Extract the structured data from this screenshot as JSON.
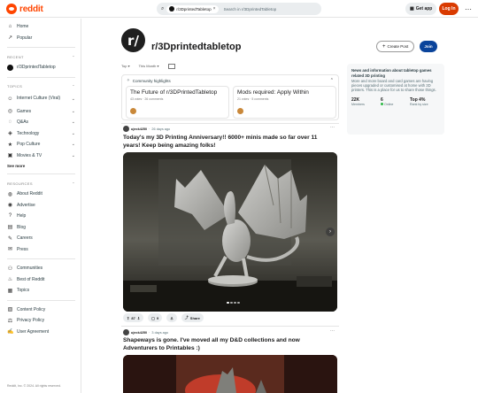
{
  "header": {
    "logo_text": "reddit",
    "search_chip": "r/3DprintedTabletop",
    "search_placeholder": "Search in r/3DprintedTabletop",
    "get_app": "Get app",
    "login": "Log In"
  },
  "sidebar": {
    "top_items": [
      {
        "label": "Home",
        "icon": "home-icon"
      },
      {
        "label": "Popular",
        "icon": "popular-icon"
      }
    ],
    "recent_heading": "RECENT",
    "recent_items": [
      {
        "label": "r/3DprintedTabletop"
      }
    ],
    "topics_heading": "TOPICS",
    "topics": [
      {
        "label": "Internet Culture (Viral)"
      },
      {
        "label": "Games"
      },
      {
        "label": "Q&As"
      },
      {
        "label": "Technology"
      },
      {
        "label": "Pop Culture"
      },
      {
        "label": "Movies & TV"
      }
    ],
    "see_more": "See more",
    "resources_heading": "RESOURCES",
    "resources": [
      {
        "label": "About Reddit"
      },
      {
        "label": "Advertise"
      },
      {
        "label": "Help"
      },
      {
        "label": "Blog"
      },
      {
        "label": "Careers"
      },
      {
        "label": "Press"
      }
    ],
    "links": [
      {
        "label": "Communities"
      },
      {
        "label": "Best of Reddit"
      },
      {
        "label": "Topics"
      }
    ],
    "policies": [
      {
        "label": "Content Policy"
      },
      {
        "label": "Privacy Policy"
      },
      {
        "label": "User Agreement"
      }
    ],
    "footer": "Reddit, Inc. © 2024. All rights reserved."
  },
  "subreddit": {
    "icon_text": "r/",
    "name": "r/3Dprintedtabletop",
    "create_post": "Create Post",
    "join": "Join"
  },
  "sort": {
    "order": "Top",
    "range": "This Month"
  },
  "highlights": {
    "heading": "Community highlights",
    "cards": [
      {
        "title": "The Future of r/3DPrintedTabletop",
        "meta": "43 votes · 26 comments"
      },
      {
        "title": "Mods required: Apply Within",
        "meta": "21 votes · 5 comments"
      }
    ]
  },
  "posts": [
    {
      "user": "ujeck4250",
      "age": "26 days ago",
      "title": "Today's my 3D Printing Anniversary!! 6000+ minis made so far over 11 years! Keep being amazing folks!",
      "votes": "87",
      "comments": "9",
      "share": "Share"
    },
    {
      "user": "ujeck4250",
      "age": "3 days ago",
      "title": "Shapeways is gone. I've moved all my D&D collections and now Adventurers to Printables :)"
    }
  ],
  "about": {
    "title": "News and information about tabletop games related 3D printing",
    "description": "More and more board and card games are having pieces upgraded or customised at home with 3D printers. This is a place for us to share those things.",
    "stats": [
      {
        "value": "22K",
        "label": "Members"
      },
      {
        "value": "6",
        "label": "Online"
      },
      {
        "value": "Top 4%",
        "label": "Rank by size"
      }
    ]
  },
  "colors": {
    "brand": "#ff4500",
    "login": "#d93a00",
    "join": "#0a449b"
  }
}
